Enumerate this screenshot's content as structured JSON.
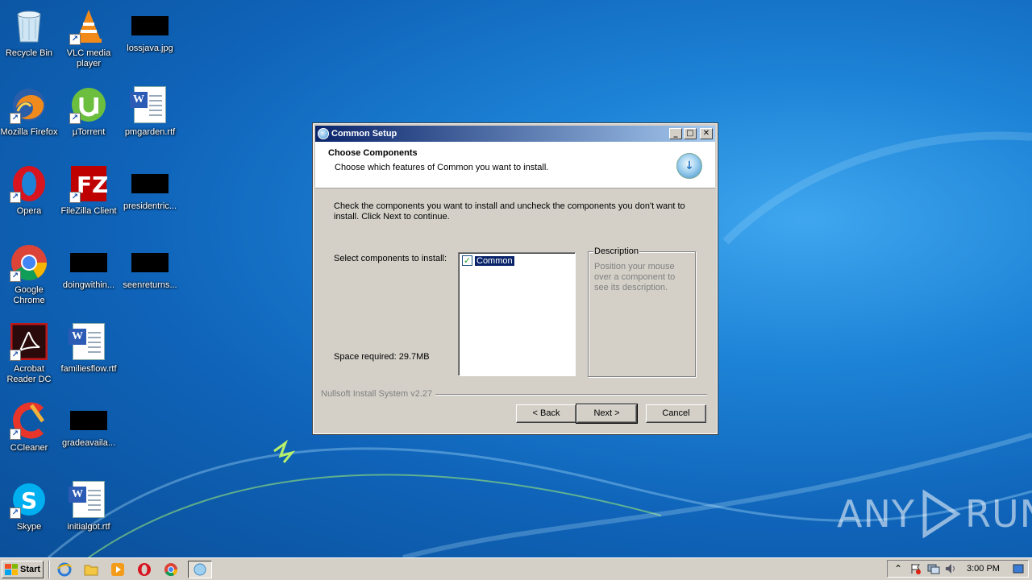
{
  "desktop": {
    "icons": [
      {
        "label": "Recycle Bin",
        "icon": "recycle-bin-icon"
      },
      {
        "label": "VLC media player",
        "icon": "vlc-icon"
      },
      {
        "label": "lossjava.jpg",
        "icon": "redacted-thumbnail"
      },
      {
        "label": "Mozilla Firefox",
        "icon": "firefox-icon"
      },
      {
        "label": "µTorrent",
        "icon": "utorrent-icon"
      },
      {
        "label": "pmgarden.rtf",
        "icon": "word-document-icon"
      },
      {
        "label": "Opera",
        "icon": "opera-icon"
      },
      {
        "label": "FileZilla Client",
        "icon": "filezilla-icon"
      },
      {
        "label": "presidentric...",
        "icon": "redacted-thumbnail"
      },
      {
        "label": "Google Chrome",
        "icon": "chrome-icon"
      },
      {
        "label": "doingwithin...",
        "icon": "redacted-thumbnail"
      },
      {
        "label": "seenreturns...",
        "icon": "redacted-thumbnail"
      },
      {
        "label": "Acrobat Reader DC",
        "icon": "acrobat-icon"
      },
      {
        "label": "familiesflow.rtf",
        "icon": "word-document-icon"
      },
      {
        "label": "CCleaner",
        "icon": "ccleaner-icon"
      },
      {
        "label": "gradeavaila...",
        "icon": "redacted-thumbnail"
      },
      {
        "label": "Skype",
        "icon": "skype-icon"
      },
      {
        "label": "initialgot.rtf",
        "icon": "word-document-icon"
      }
    ]
  },
  "dialog": {
    "title": "Common Setup",
    "header_title": "Choose Components",
    "header_subtitle": "Choose which features of Common you want to install.",
    "instructions": "Check the components you want to install and uncheck the components you don't want to install. Click Next to continue.",
    "select_label": "Select components to install:",
    "space_required": "Space required: 29.7MB",
    "components": [
      {
        "name": "Common",
        "checked": true
      }
    ],
    "description_legend": "Description",
    "description_text": "Position your mouse over a component to see its description.",
    "branding": "Nullsoft Install System v2.27",
    "buttons": {
      "back": "< Back",
      "next": "Next >",
      "cancel": "Cancel"
    }
  },
  "taskbar": {
    "start_label": "Start",
    "quick_launch": [
      "ie-icon",
      "explorer-folder-icon",
      "media-player-icon",
      "opera-icon",
      "chrome-icon",
      "setup-task-icon"
    ],
    "clock": "3:00 PM"
  },
  "watermark": {
    "left": "ANY",
    "right": "RUN"
  }
}
